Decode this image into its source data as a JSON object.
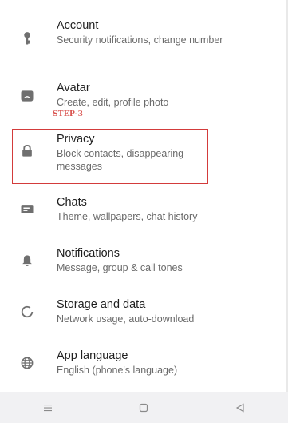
{
  "settings": {
    "items": [
      {
        "title": "Account",
        "subtitle": "Security notifications, change number",
        "icon": "key-icon"
      },
      {
        "title": "Avatar",
        "subtitle": "Create, edit, profile photo",
        "icon": "avatar-icon"
      },
      {
        "title": "Privacy",
        "subtitle": "Block contacts, disappearing messages",
        "icon": "lock-icon"
      },
      {
        "title": "Chats",
        "subtitle": "Theme, wallpapers, chat history",
        "icon": "chat-icon"
      },
      {
        "title": "Notifications",
        "subtitle": "Message, group & call tones",
        "icon": "bell-icon"
      },
      {
        "title": "Storage and data",
        "subtitle": "Network usage, auto-download",
        "icon": "storage-circle-icon"
      },
      {
        "title": "App language",
        "subtitle": "English (phone's language)",
        "icon": "globe-icon"
      }
    ]
  },
  "annotation": {
    "step_label": "STEP-3",
    "highlight_color": "#d33b3b"
  },
  "navbar": {
    "buttons": [
      "menu-icon",
      "home-square-icon",
      "back-triangle-icon"
    ]
  }
}
